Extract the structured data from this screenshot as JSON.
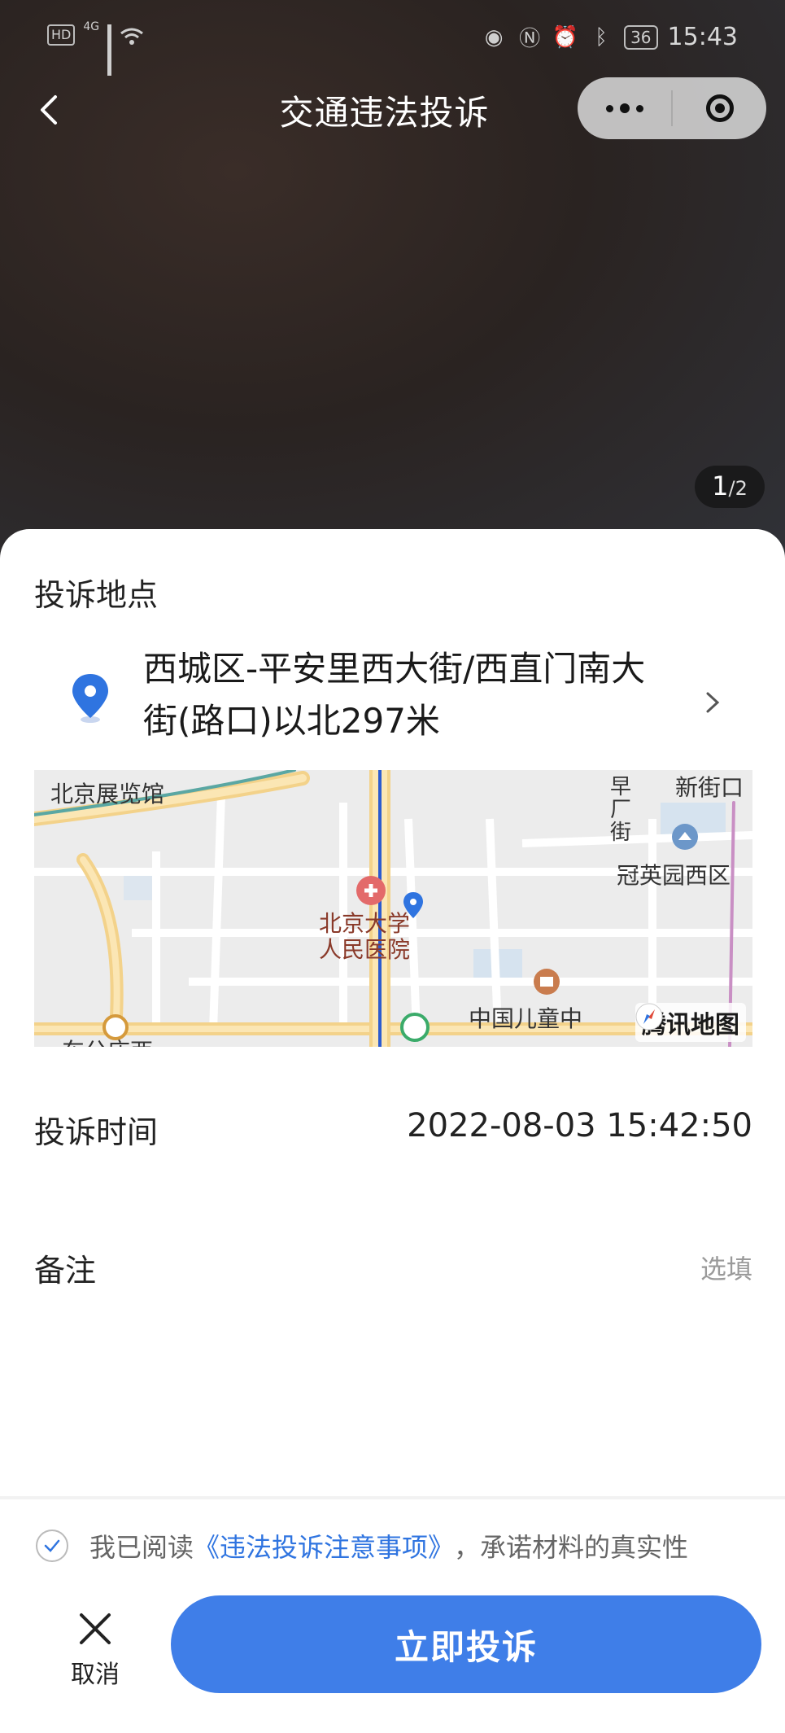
{
  "status_bar": {
    "network_badge": "HD",
    "network_type": "4G",
    "battery": "36",
    "time": "15:43"
  },
  "nav": {
    "title": "交通违法投诉"
  },
  "gallery": {
    "current": "1",
    "total": "/2"
  },
  "location": {
    "section_label": "投诉地点",
    "address": "西城区-平安里西大街/西直门南大街(路口)以北297米"
  },
  "map": {
    "labels": {
      "exhibition": "北京展览馆",
      "xinjiekou": "新街口",
      "zaochangjie_1": "早",
      "zaochangjie_2": "厂",
      "zaochangjie_3": "街",
      "guanyingyuan": "冠英园西区",
      "hospital_1": "北京大学",
      "hospital_2": "人民医院",
      "children": "中国儿童中",
      "cut_label": "车公庄西"
    },
    "brand": "腾讯地图"
  },
  "time_row": {
    "label": "投诉时间",
    "value": "2022-08-03 15:42:50"
  },
  "note_row": {
    "label": "备注",
    "placeholder": "选填"
  },
  "agreement": {
    "prefix": "我已阅读",
    "link": "《违法投诉注意事项》",
    "suffix": "，承诺材料的真实性"
  },
  "actions": {
    "cancel": "取消",
    "submit": "立即投诉"
  },
  "colors": {
    "accent": "#3f7ee8",
    "link": "#2f74e0",
    "pin": "#2f74e0"
  }
}
